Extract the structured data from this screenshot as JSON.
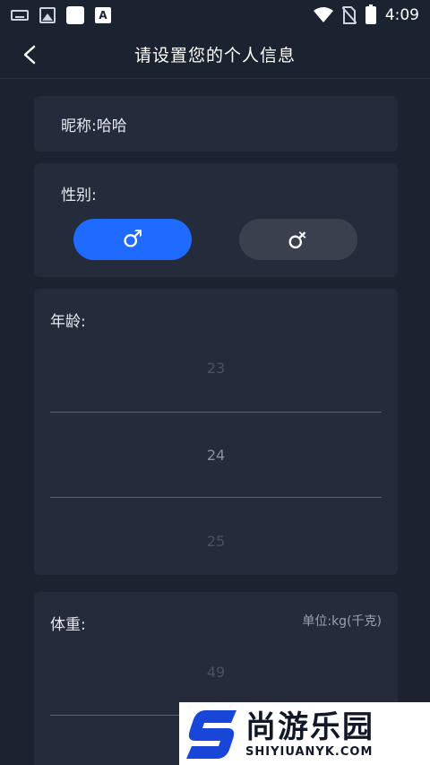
{
  "status_bar": {
    "time": "4:09",
    "icons": [
      "keyboard-icon",
      "image-icon",
      "app-square-icon",
      "font-a-icon",
      "wifi-icon",
      "no-sim-icon",
      "battery-icon"
    ]
  },
  "header": {
    "title": "请设置您的个人信息",
    "back_icon": "chevron-left-icon"
  },
  "nickname": {
    "label": "昵称:",
    "value": "哈哈"
  },
  "gender": {
    "label": "性别:",
    "male_symbol": "♂",
    "female_symbol": "♀",
    "selected": "male"
  },
  "age": {
    "label": "年龄:",
    "values": [
      "23",
      "24",
      "25"
    ],
    "selected": "24"
  },
  "weight": {
    "label": "体重:",
    "unit": "单位:kg(千克)",
    "values": [
      "49"
    ]
  },
  "watermark": {
    "cn": "尚游乐园",
    "en": "SHIYIUANYK.COM"
  },
  "colors": {
    "background": "#1b2230",
    "card": "#242b3a",
    "accent": "#1f6bff",
    "inactive_button": "#3a404d"
  }
}
